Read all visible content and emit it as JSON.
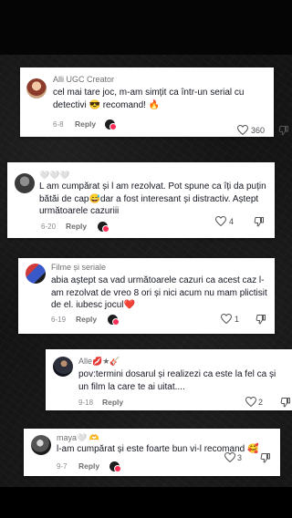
{
  "comments": [
    {
      "username": "Alli UGC Creator",
      "text": "cel mai tare joc, m-am simțit ca într-un serial cu detectivi 😎 recomand! 🔥",
      "date": "6-8",
      "reply": "Reply",
      "likes": "360"
    },
    {
      "username": "🤍🤍🤍",
      "text": "L am cumpărat și l am rezolvat. Pot spune ca îți da puțin bătăi de cap😅dar a fost interesant și distractiv. Aștept următoarele cazuriii",
      "date": "6-20",
      "reply": "Reply",
      "likes": "4"
    },
    {
      "username": "Filme și seriale",
      "text": "abia aștept sa vad următoarele cazuri ca acest caz l-am rezolvat de vreo 8 ori și nici acum nu mam plictisit de el. iubesc jocul❤️",
      "date": "6-19",
      "reply": "Reply",
      "likes": "1"
    },
    {
      "username": "Alle💋★🎸",
      "text": "pov:termini dosarul și realizezi ca este la fel ca și un film la care te ai uitat....",
      "date": "9-18",
      "reply": "Reply",
      "likes": "2"
    },
    {
      "username": "maya🤍 🫶",
      "text": "l-am cumpărat și este foarte bun vi-l recomand 🥰",
      "date": "9-7",
      "reply": "Reply",
      "likes": "3"
    }
  ]
}
